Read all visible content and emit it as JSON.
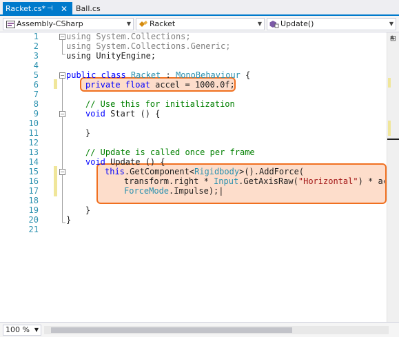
{
  "tabs": [
    {
      "label": "Racket.cs*",
      "active": true
    },
    {
      "label": "Ball.cs",
      "active": false
    }
  ],
  "tab_icons": {
    "pin": "pin-icon",
    "close": "close-icon"
  },
  "nav": {
    "project": "Assembly-CSharp",
    "class": "Racket",
    "member": "Update()"
  },
  "zoom": "100 %",
  "line_numbers": [
    "1",
    "2",
    "3",
    "4",
    "5",
    "6",
    "7",
    "8",
    "9",
    "10",
    "11",
    "12",
    "13",
    "14",
    "15",
    "16",
    "17",
    "18",
    "19",
    "20",
    "21"
  ],
  "code": {
    "l1_kw": "using",
    "l1_rest": " System.Collections;",
    "l2_kw": "using",
    "l2_rest": " System.Collections.Generic;",
    "l3": "using UnityEngine;",
    "l5_kw1": "public",
    "l5_kw2": " class ",
    "l5_name": "Racket",
    "l5_sep": " : ",
    "l5_base": "MonoBehaviour",
    "l5_end": " {",
    "l6_kw1": "private",
    "l6_kw2": " float",
    "l6_rest": " accel = 1000.0f;",
    "l8": "// Use this for initialization",
    "l9_kw": "void",
    "l9_rest": " Start () {",
    "l10": "",
    "l11": "}",
    "l13": "// Update is called once per frame",
    "l14_kw": "void",
    "l14_rest": " Update () {",
    "l15_this": "this",
    "l15_a": ".GetComponent<",
    "l15_type": "Rigidbody",
    "l15_b": ">().AddForce(",
    "l16_a": "transform.right * ",
    "l16_type": "Input",
    "l16_b": ".GetAxisRaw(",
    "l16_str": "\"Horizontal\"",
    "l16_c": ") * accel,",
    "l17_type": "ForceMode",
    "l17_rest": ".Impulse);|",
    "l19": "}",
    "l20": "}"
  },
  "colors": {
    "accent": "#007acc",
    "keyword": "#0000ff",
    "type": "#2b91af",
    "comment": "#008000",
    "string": "#a31515",
    "highlight_border": "#f07020"
  }
}
